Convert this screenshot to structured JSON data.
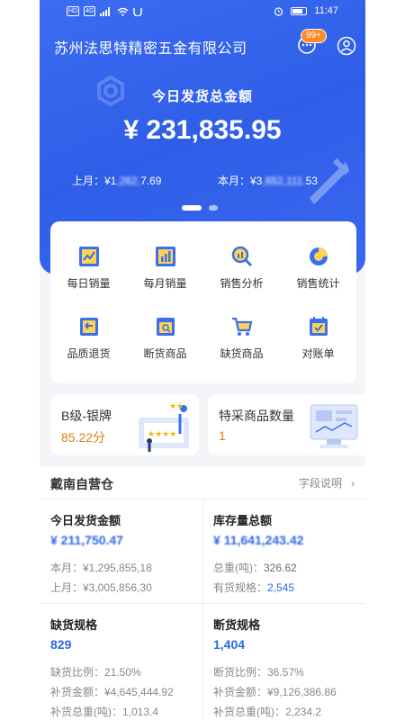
{
  "status": {
    "left_chips": [
      "HD",
      "4G"
    ],
    "time": "11:47"
  },
  "header": {
    "company": "苏州法思特精密五金有限公司",
    "badge": "99+"
  },
  "hero": {
    "title": "今日发货总金额",
    "amount": "¥ 231,835.95",
    "last_month_label": "上月：¥1",
    "last_month_tail": "7.69",
    "this_month_label": "本月：¥3",
    "this_month_tail": "53"
  },
  "menu": {
    "items": [
      {
        "label": "每日销量",
        "icon": "daily-sales-icon"
      },
      {
        "label": "每月销量",
        "icon": "monthly-sales-icon"
      },
      {
        "label": "销售分析",
        "icon": "sales-analysis-icon"
      },
      {
        "label": "销售统计",
        "icon": "sales-stats-icon"
      },
      {
        "label": "品质退货",
        "icon": "quality-return-icon"
      },
      {
        "label": "断货商品",
        "icon": "out-of-stock-icon"
      },
      {
        "label": "缺货商品",
        "icon": "shortage-cart-icon"
      },
      {
        "label": "对账单",
        "icon": "statement-icon"
      }
    ]
  },
  "cards": {
    "rating": {
      "title": "B级-银牌",
      "value": "85.22分"
    },
    "special": {
      "title": "特采商品数量",
      "value": "1"
    }
  },
  "warehouse": {
    "name": "戴南自营仓",
    "link": "字段说明",
    "cells": {
      "shipped": {
        "title": "今日发货金额",
        "value": "¥ 211,750.47",
        "row1": "本月：¥1,295,855,18",
        "row2": "上月：¥3,005,856,30"
      },
      "stock": {
        "title": "库存量总额",
        "value": "¥ 11,641,243.42",
        "row1_label": "总重(吨)：",
        "row1_value": "326.62",
        "row2_label": "有货规格：",
        "row2_value": "2,545"
      },
      "shortage": {
        "title": "缺货规格",
        "value": "829",
        "row1": "缺货比例：21.50%",
        "row2": "补货金额：¥4,645,444.92",
        "row3": "补货总重(吨)：1,013.4"
      },
      "outstock": {
        "title": "断货规格",
        "value": "1,404",
        "row1": "断货比例：36.57%",
        "row2": "补货金额：¥9,126,386.86",
        "row3": "补货总重(吨)：2,234.2"
      }
    }
  },
  "colors": {
    "primary": "#2f5ee8",
    "accent_blue": "#2f67e6",
    "orange": "#e07d10",
    "badge": "#ff8a2a"
  }
}
